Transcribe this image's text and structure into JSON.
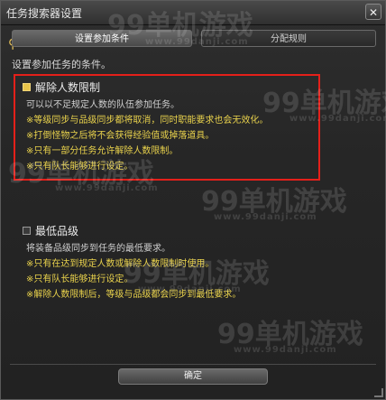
{
  "window": {
    "title": "任务搜索器设置",
    "close_label": "✕"
  },
  "tabs": [
    {
      "label": "设置参加条件",
      "active": true
    },
    {
      "label": "分配规则",
      "active": false
    }
  ],
  "intro": "设置参加任务的条件。",
  "options": [
    {
      "title": "解除人数限制",
      "checked": true,
      "description": "可以以不足规定人数的队伍参加任务。",
      "notes": [
        "※等级同步与品级同步都将取消，同时职能要求也会无效化。",
        "※打倒怪物之后将不会获得经验值或掉落道具。",
        "※只有一部分任务允许解除人数限制。",
        "※只有队长能够进行设定。"
      ]
    },
    {
      "title": "最低品级",
      "checked": false,
      "description": "将装备品级同步到任务的最低要求。",
      "notes": [
        "※只有在达到规定人数或解除人数限制时使用。",
        "※只有队长能够进行设定。",
        "※解除人数限制后，等级与品级都会同步到最低要求。"
      ]
    }
  ],
  "footer": {
    "ok_label": "确定"
  },
  "watermarks": {
    "big": "99单机游戏",
    "small": "www.99danji.com"
  },
  "colors": {
    "highlight_box": "#e4201a",
    "note_text": "#e9d24c",
    "checkbox_checked": "#e8c44a"
  }
}
